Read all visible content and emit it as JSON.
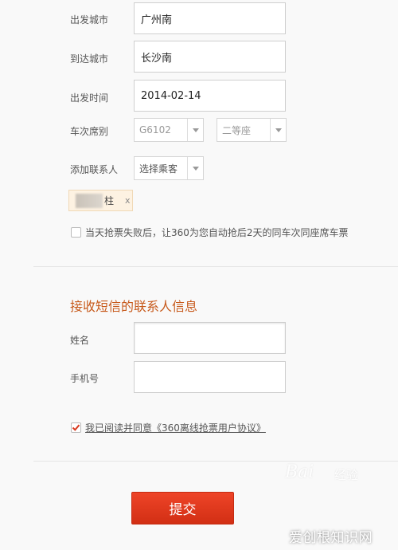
{
  "form": {
    "departure": {
      "label": "出发城市",
      "value": "广州南"
    },
    "arrival": {
      "label": "到达城市",
      "value": "长沙南"
    },
    "date": {
      "label": "出发时间",
      "value": "2014-02-14"
    },
    "train": {
      "label": "车次席别",
      "train_no": "G6102",
      "seat_class": "二等座"
    },
    "contacts": {
      "label": "添加联系人",
      "select_placeholder": "选择乘客",
      "chip_text": "柱",
      "chip_close": "x"
    },
    "auto_grab_option": "当天抢票失败后，让360为您自动抢后2天的同车次同座席车票"
  },
  "sms_section": {
    "title": "接收短信的联系人信息",
    "name_label": "姓名",
    "name_value": "",
    "phone_label": "手机号",
    "phone_value": "",
    "agreement_text": "我已阅读并同意《360离线抢票用户协议》",
    "agreement_checked": true
  },
  "submit_label": "提交",
  "watermark": {
    "logo_text": "Bai",
    "site_text": "经验",
    "corner_text": "爱创根知识网"
  },
  "colors": {
    "accent": "#c75a1c",
    "submit": "#e03a1e",
    "check": "#d9381e"
  }
}
